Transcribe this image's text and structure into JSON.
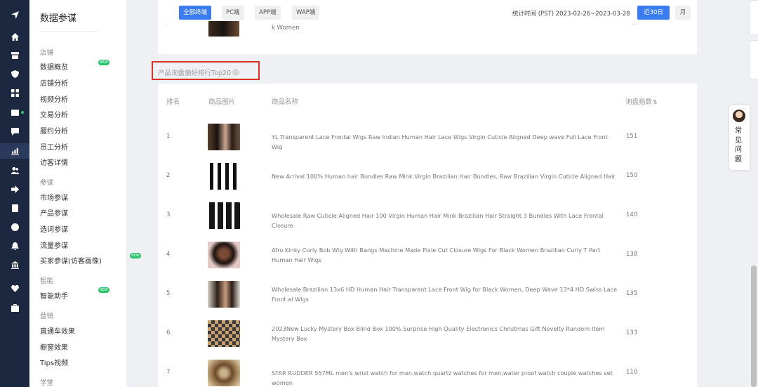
{
  "sidebar_menu": {
    "title": "数据参谋",
    "groups": [
      {
        "label": "店铺",
        "items": [
          {
            "label": "数据概览",
            "new": true
          },
          {
            "label": "店铺分析"
          },
          {
            "label": "视频分析"
          },
          {
            "label": "交易分析"
          },
          {
            "label": "履约分析"
          },
          {
            "label": "员工分析"
          },
          {
            "label": "访客详情"
          }
        ]
      },
      {
        "label": "参谋",
        "items": [
          {
            "label": "市场参谋"
          },
          {
            "label": "产品参谋"
          },
          {
            "label": "选词参谋"
          },
          {
            "label": "流量参谋"
          },
          {
            "label": "买家参谋(访客画像)",
            "new": true
          }
        ]
      },
      {
        "label": "智能",
        "items": [
          {
            "label": "智能助手",
            "new": true
          }
        ]
      },
      {
        "label": "营销",
        "items": [
          {
            "label": "直通车效果"
          },
          {
            "label": "橱窗效果"
          },
          {
            "label": "Tips视频"
          }
        ]
      },
      {
        "label": "学堂",
        "items": []
      }
    ],
    "new_badge": "NEW"
  },
  "icons": {
    "rail": [
      "send-icon",
      "home-icon",
      "store-icon",
      "shield-icon",
      "grid-icon",
      "video-icon",
      "chat-icon",
      "chart-icon",
      "users-icon",
      "share-icon",
      "document-icon",
      "globe-icon",
      "bell-icon",
      "bank-icon",
      "heart-icon",
      "briefcase-icon"
    ]
  },
  "filters": {
    "terminals": [
      "全部终端",
      "PC端",
      "APP端",
      "WAP端"
    ],
    "active_terminal": "全部终端",
    "stat_time": "统计时间 (PST) 2023-02-26~2023-03-28",
    "period_30": "近30日",
    "period_month": "月"
  },
  "previous_row_fragment": {
    "name_tail": "k Women",
    "rank": "-",
    "score": "--"
  },
  "section": {
    "title": "产品询盘偏好排行Top20"
  },
  "table": {
    "headers": {
      "rank": "排名",
      "image": "商品图片",
      "name": "商品名称",
      "score": "询盘指数"
    },
    "rows": [
      {
        "rank": "1",
        "name": "YL Transparent Lace Frontal Wigs Raw Indian Human Hair Lace Wigs Virgin Cuticle Aligned Deep wave Full Lace Front Wig",
        "score": "151"
      },
      {
        "rank": "2",
        "name": "New Arrival 100% Human hair Bundles Raw Mink Virgin Brazilian Hair Bundles, Raw Brazilian Virgin Cuticle Aligned Hair",
        "score": "150"
      },
      {
        "rank": "3",
        "name": "Wholesale Raw Cuticle Aligned Hair 100 Virgin Human Hair Mink Brazilian Hair Straight 3 Bundles With Lace Frontal Closure",
        "score": "140"
      },
      {
        "rank": "4",
        "name": "Afro Kinky Curly Bob Wig With Bangs Machine Made Pixie Cut Closure Wigs For Black Women Brazilian Curly T Part Human Hair Wigs",
        "score": "138"
      },
      {
        "rank": "5",
        "name": "Wholesale Brazilian 13x6 HD Human Hair Transparent Lace Front Wig for Black Women, Deep Wave 13*4 HD Swiss Lace Front al Wigs",
        "score": "135"
      },
      {
        "rank": "6",
        "name": "2023New Lucky Mystery Box Blind Box 100% Surprise High Quality Electronics Christmas Gift Novelty Random Item Mystery Box",
        "score": "133"
      },
      {
        "rank": "7",
        "name": "STAR RUDDER 557ML men's wrist watch for men,watch quartz watches for men,water proof watch couple watches set women",
        "score": "110"
      }
    ]
  },
  "faq": {
    "label": "常见问题"
  }
}
